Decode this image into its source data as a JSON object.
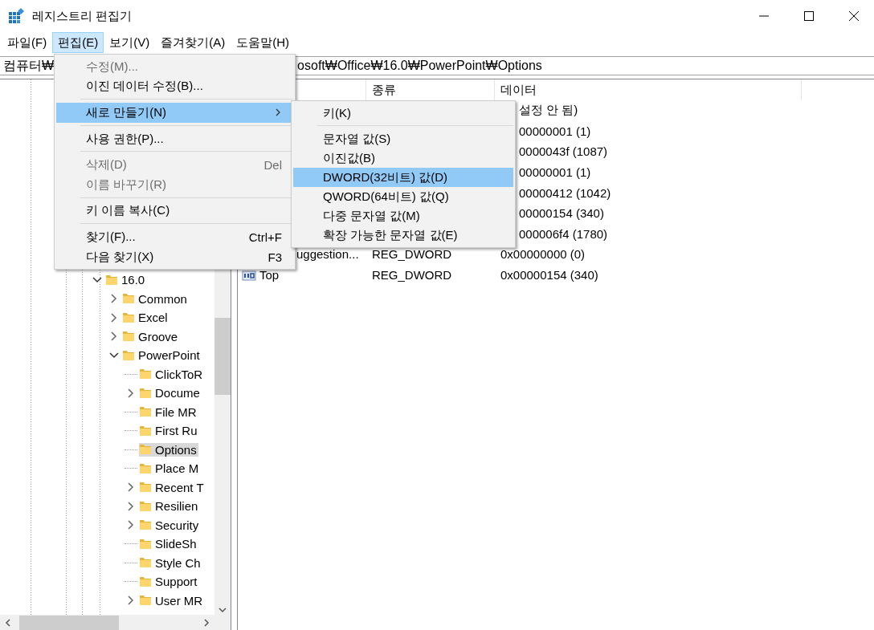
{
  "window": {
    "title": "레지스트리 편집기"
  },
  "menu_bar": [
    {
      "label": "파일(F)",
      "selected": false
    },
    {
      "label": "편집(E)",
      "selected": true
    },
    {
      "label": "보기(V)",
      "selected": false
    },
    {
      "label": "즐겨찾기(A)",
      "selected": false
    },
    {
      "label": "도움말(H)",
      "selected": false
    }
  ],
  "address": {
    "start": "컴퓨터₩",
    "end": "osoft₩Office₩16.0₩PowerPoint₩Options"
  },
  "tree": {
    "items": [
      {
        "label": "16.0",
        "expandable": true,
        "expanded": true,
        "selected": false,
        "children": [
          {
            "label": "Common",
            "expandable": true,
            "expanded": false,
            "selected": false
          },
          {
            "label": "Excel",
            "expandable": true,
            "expanded": false,
            "selected": false
          },
          {
            "label": "Groove",
            "expandable": true,
            "expanded": false,
            "selected": false
          },
          {
            "label": "PowerPoint",
            "expandable": true,
            "expanded": true,
            "selected": false,
            "children": [
              {
                "label": "ClickToR",
                "expandable": false,
                "selected": false
              },
              {
                "label": "Docume",
                "expandable": true,
                "expanded": false,
                "selected": false
              },
              {
                "label": "File MR",
                "expandable": false,
                "selected": false
              },
              {
                "label": "First Ru",
                "expandable": false,
                "selected": false
              },
              {
                "label": "Options",
                "expandable": false,
                "selected": true
              },
              {
                "label": "Place M",
                "expandable": false,
                "selected": false
              },
              {
                "label": "Recent T",
                "expandable": true,
                "expanded": false,
                "selected": false
              },
              {
                "label": "Resilien",
                "expandable": true,
                "expanded": false,
                "selected": false
              },
              {
                "label": "Security",
                "expandable": true,
                "expanded": false,
                "selected": false
              },
              {
                "label": "SlideSh",
                "expandable": false,
                "selected": false
              },
              {
                "label": "Style Ch",
                "expandable": false,
                "selected": false
              },
              {
                "label": "Support",
                "expandable": false,
                "selected": false
              },
              {
                "label": "User MR",
                "expandable": true,
                "expanded": false,
                "selected": false
              }
            ]
          }
        ]
      }
    ]
  },
  "list": {
    "type_header": "종류",
    "data_header": "데이터",
    "rows": [
      {
        "kind": "covered",
        "data": "설정 안 됨)"
      },
      {
        "kind": "covered",
        "data": "00000001 (1)"
      },
      {
        "kind": "covered",
        "data": "0000043f (1087)"
      },
      {
        "kind": "covered",
        "data": "00000001 (1)"
      },
      {
        "kind": "covered",
        "data": "00000412 (1042)"
      },
      {
        "kind": "covered",
        "data": "00000154 (340)"
      },
      {
        "kind": "covered",
        "data": "000006f4 (1780)"
      },
      {
        "kind": "partial",
        "name": "uggestion...",
        "type": "REG_DWORD",
        "data": "0x00000000 (0)"
      },
      {
        "kind": "full",
        "name": "Top",
        "type": "REG_DWORD",
        "data": "0x00000154 (340)"
      }
    ]
  },
  "edit_menu": {
    "items": [
      {
        "kind": "item",
        "label": "수정(M)...",
        "disabled": true,
        "highlighted": false
      },
      {
        "kind": "item",
        "label": "이진 데이터 수정(B)...",
        "disabled": false,
        "highlighted": false
      },
      {
        "kind": "separator"
      },
      {
        "kind": "submenu",
        "label": "새로 만들기(N)",
        "disabled": false,
        "highlighted": true
      },
      {
        "kind": "separator"
      },
      {
        "kind": "item",
        "label": "사용 권한(P)...",
        "disabled": false,
        "highlighted": false
      },
      {
        "kind": "separator"
      },
      {
        "kind": "item",
        "label": "삭제(D)",
        "shortcut": "Del",
        "disabled": true,
        "highlighted": false
      },
      {
        "kind": "item",
        "label": "이름 바꾸기(R)",
        "disabled": true,
        "highlighted": false
      },
      {
        "kind": "separator"
      },
      {
        "kind": "item",
        "label": "키 이름 복사(C)",
        "disabled": false,
        "highlighted": false
      },
      {
        "kind": "separator"
      },
      {
        "kind": "item",
        "label": "찾기(F)...",
        "shortcut": "Ctrl+F",
        "disabled": false,
        "highlighted": false
      },
      {
        "kind": "item",
        "label": "다음 찾기(X)",
        "shortcut": "F3",
        "disabled": false,
        "highlighted": false
      }
    ]
  },
  "new_submenu": {
    "items": [
      {
        "kind": "item",
        "label": "키(K)",
        "disabled": false,
        "highlighted": false
      },
      {
        "kind": "separator"
      },
      {
        "kind": "item",
        "label": "문자열 값(S)",
        "disabled": false,
        "highlighted": false
      },
      {
        "kind": "item",
        "label": "이진값(B)",
        "disabled": false,
        "highlighted": false
      },
      {
        "kind": "item",
        "label": "DWORD(32비트) 값(D)",
        "disabled": false,
        "highlighted": true
      },
      {
        "kind": "item",
        "label": "QWORD(64비트) 값(Q)",
        "disabled": false,
        "highlighted": false
      },
      {
        "kind": "item",
        "label": "다중 문자열 값(M)",
        "disabled": false,
        "highlighted": false
      },
      {
        "kind": "item",
        "label": "확장 가능한 문자열 값(E)",
        "disabled": false,
        "highlighted": false
      }
    ]
  }
}
